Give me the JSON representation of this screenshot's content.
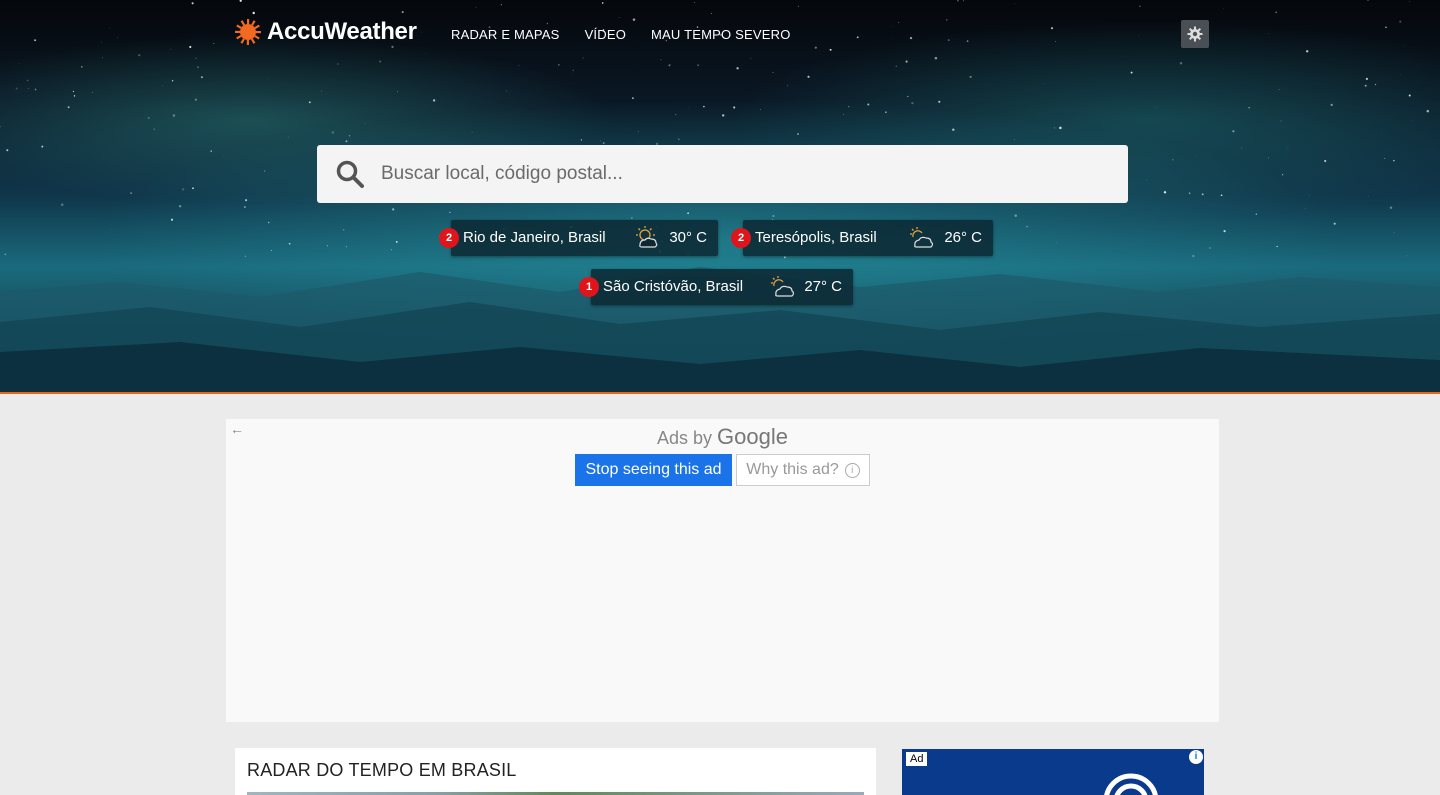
{
  "header": {
    "brand": "AccuWeather",
    "nav": [
      "RADAR E MAPAS",
      "VÍDEO",
      "MAU TEMPO SEVERO"
    ],
    "settings_icon": "gear-icon"
  },
  "search": {
    "placeholder": "Buscar local, código postal..."
  },
  "recent_locations": [
    {
      "badge": "2",
      "name": "Rio de Janeiro, Brasil",
      "temp": "30° C",
      "icon": "partly-sunny-icon"
    },
    {
      "badge": "2",
      "name": "Teresópolis, Brasil",
      "temp": "26° C",
      "icon": "partly-cloudy-icon"
    },
    {
      "badge": "1",
      "name": "São Cristóvão, Brasil",
      "temp": "27° C",
      "icon": "partly-cloudy-icon"
    }
  ],
  "ad": {
    "ads_by": "Ads by",
    "google": "Google",
    "stop": "Stop seeing this ad",
    "why": "Why this ad?",
    "info": "i"
  },
  "radar": {
    "title": "RADAR DO TEMPO EM BRASIL"
  },
  "side_ad": {
    "tag": "Ad",
    "info": "i"
  },
  "colors": {
    "accent": "#e8641b",
    "badge": "#e0151b",
    "ad_button": "#1a73e8"
  }
}
